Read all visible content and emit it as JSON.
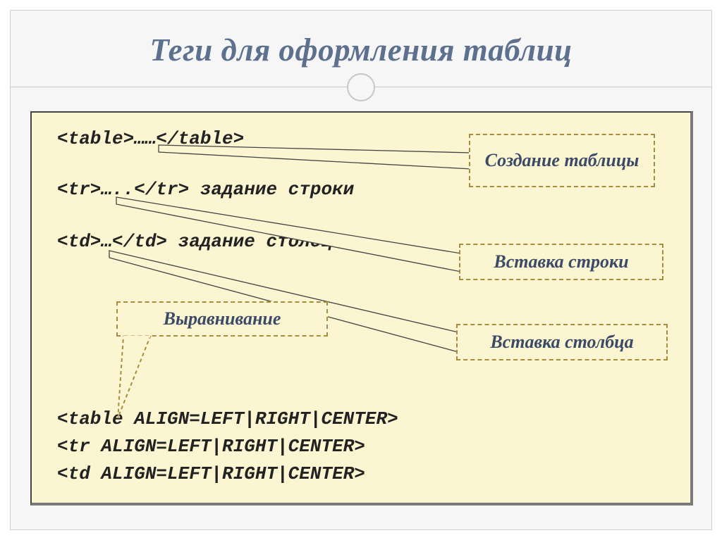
{
  "title": "Теги для оформления таблиц",
  "code": {
    "line_table": "<table>……</table>",
    "line_tr": "<tr>…..</tr> задание строки",
    "line_td": "<td>…</td> задание столбца",
    "align_table": "<table ALIGN=LEFT|RIGHT|CENTER>",
    "align_tr": "<tr ALIGN=LEFT|RIGHT|CENTER>",
    "align_td": "<td ALIGN=LEFT|RIGHT|CENTER>"
  },
  "callouts": {
    "create": "Создание таблицы",
    "row": "Вставка строки",
    "col": "Вставка столбца",
    "align": "Выравнивание"
  }
}
